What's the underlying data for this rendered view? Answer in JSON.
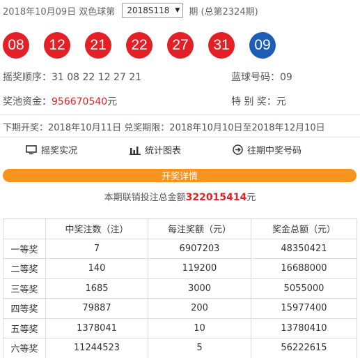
{
  "header": {
    "date_prefix": "2018年10月09日 双色球第",
    "issue_selected": "2018S118",
    "issue_suffix": "期 (总第2324期)"
  },
  "balls": {
    "red": [
      "08",
      "12",
      "21",
      "22",
      "27",
      "31"
    ],
    "blue": "09",
    "colors": {
      "red": "#e32025",
      "blue": "#1d5db6"
    }
  },
  "draw": {
    "order_label": "摇奖顺序：",
    "order_value": "31 08 22 12 27 21",
    "blue_label": "蓝球号码：",
    "blue_value": "09",
    "pool_label": "奖池资金：",
    "pool_value": "956670540",
    "pool_unit": "元",
    "special_label": "特 别 奖：",
    "special_value": "元"
  },
  "dates_text": "下期开奖：2018年10月11日 兑奖期限：2018年10月10日至2018年12月10日",
  "links": {
    "live": "摇奖实况",
    "chart": "统计图表",
    "history": "往期中奖号码",
    "icons": [
      "monitor-icon",
      "bar-chart-icon",
      "arrow-circle-icon"
    ]
  },
  "detail_label": "开奖详情",
  "sales": {
    "prefix": "本期联销投注总金额",
    "amount": "322015414",
    "unit": "元"
  },
  "table": {
    "headers": [
      "",
      "中奖注数（注）",
      "每注奖额（元）",
      "奖金总额（元）"
    ],
    "rows": [
      [
        "一等奖",
        "7",
        "6907203",
        "48350421"
      ],
      [
        "二等奖",
        "140",
        "119200",
        "16688000"
      ],
      [
        "三等奖",
        "1685",
        "3000",
        "5055000"
      ],
      [
        "四等奖",
        "79887",
        "200",
        "15977400"
      ],
      [
        "五等奖",
        "1378041",
        "10",
        "13780410"
      ],
      [
        "六等奖",
        "11244523",
        "5",
        "56222615"
      ]
    ]
  },
  "accent_colors": {
    "orange": "#f7941d",
    "red": "#e32025"
  }
}
